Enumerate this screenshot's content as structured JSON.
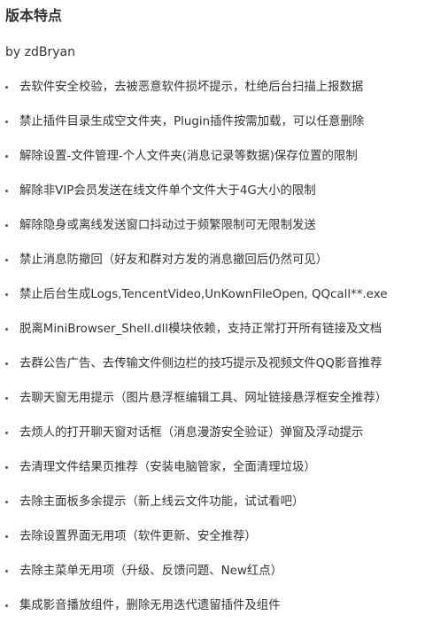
{
  "section": {
    "title": "版本特点",
    "author": "by zdBryan"
  },
  "features": [
    "去软件安全校验，去被恶意软件损坏提示，杜绝后台扫描上报数据",
    "禁止插件目录生成空文件夹，Plugin插件按需加载，可以任意删除",
    "解除设置-文件管理-个人文件夹(消息记录等数据)保存位置的限制",
    "解除非VIP会员发送在线文件单个文件大于4G大小的限制",
    "解除隐身或离线发送窗口抖动过于频繁限制可无限制发送",
    "禁止消息防撤回（好友和群对方发的消息撤回后仍然可见）",
    "禁止后台生成Logs,TencentVideo,UnKownFileOpen, QQcall**.exe",
    "脱离MiniBrowser_Shell.dll模块依赖，支持正常打开所有链接及文档",
    "去群公告广告、去传输文件侧边栏的技巧提示及视频文件QQ影音推荐",
    "去聊天窗无用提示（图片悬浮框编辑工具、网址链接悬浮框安全推荐）",
    "去烦人的打开聊天窗对话框（消息漫游安全验证）弹窗及浮动提示",
    "去清理文件结果页推荐（安装电脑管家，全面清理垃圾）",
    "去除主面板多余提示（新上线云文件功能，试试看吧）",
    "去除设置界面无用项（软件更新、安全推荐）",
    "去除主菜单无用项（升级、反馈问题、New红点）",
    "集成影音播放组件，删除无用迭代遗留插件及组件"
  ]
}
